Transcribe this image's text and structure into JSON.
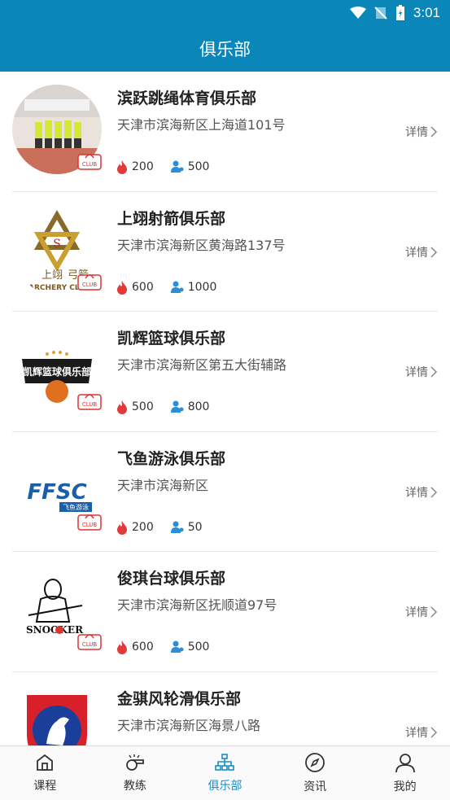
{
  "status": {
    "time": "3:01"
  },
  "header": {
    "title": "俱乐部"
  },
  "detail_label": "详情",
  "clubs": [
    {
      "name": "滨跃跳绳体育俱乐部",
      "address": "天津市滨海新区上海道101号",
      "heat": "200",
      "members": "500",
      "logo_icon": "jump-rope-team-photo"
    },
    {
      "name": "上翊射箭俱乐部",
      "address": "天津市滨海新区黄海路137号",
      "heat": "600",
      "members": "1000",
      "logo_icon": "archery-star-logo",
      "logo_text_top": "上翊",
      "logo_text_right": "弓箭",
      "logo_text_bottom": "ARCHERY CL"
    },
    {
      "name": "凯辉篮球俱乐部",
      "address": "天津市滨海新区第五大街辅路",
      "heat": "500",
      "members": "800",
      "logo_icon": "basketball-logo",
      "logo_text": "凯辉篮球俱乐部"
    },
    {
      "name": "飞鱼游泳俱乐部",
      "address": "天津市滨海新区",
      "heat": "200",
      "members": "50",
      "logo_icon": "swim-fish-logo",
      "logo_text": "FFSC",
      "logo_sub": "飞鱼游泳"
    },
    {
      "name": "俊琪台球俱乐部",
      "address": "天津市滨海新区抚顺道97号",
      "heat": "600",
      "members": "500",
      "logo_icon": "snooker-player-logo",
      "logo_text": "SNOOKER"
    },
    {
      "name": "金骐风轮滑俱乐部",
      "address": "天津市滨海新区海景八路",
      "heat": "",
      "members": "",
      "logo_icon": "horse-shield-logo"
    }
  ],
  "tabs": [
    {
      "label": "课程",
      "icon": "home-icon"
    },
    {
      "label": "教练",
      "icon": "whistle-icon"
    },
    {
      "label": "俱乐部",
      "icon": "org-chart-icon",
      "active": true
    },
    {
      "label": "资讯",
      "icon": "compass-icon"
    },
    {
      "label": "我的",
      "icon": "person-icon"
    }
  ],
  "colors": {
    "primary": "#0a86b8",
    "active_tab": "#1a8fc7",
    "heat": "#e03a3a",
    "members": "#2a8fd8"
  }
}
